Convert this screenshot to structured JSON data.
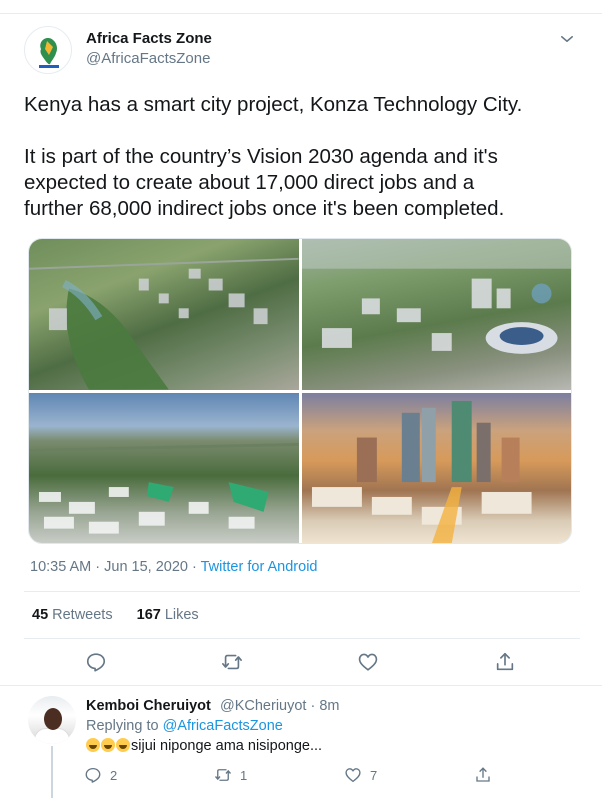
{
  "tweet": {
    "author_name": "Africa Facts Zone",
    "author_handle": "@AfricaFactsZone",
    "text_line1": "Kenya has a smart city project, Konza Technology City.",
    "text_line2": "It is part of the country’s Vision 2030 agenda and it's",
    "text_line3": "expected to create about 17,000 direct jobs and a",
    "text_line4": "further 68,000 indirect jobs once it's been completed.",
    "timestamp": "10:35 AM · Jun 15, 2020",
    "separator": " · ",
    "source": "Twitter for Android",
    "retweets_count": "45",
    "retweets_label": "Retweets",
    "likes_count": "167",
    "likes_label": "Likes",
    "media": [
      "city-render-1",
      "city-render-2",
      "city-render-3",
      "city-render-4"
    ]
  },
  "reply": {
    "author_name": "Kemboi Cheruiyot",
    "author_handle": "@KCheriuyot",
    "time": "· 8m",
    "replying_prefix": "Replying to",
    "replying_to": "@AfricaFactsZone",
    "text": "sijui niponge ama nisiponge...",
    "reply_count": "2",
    "retweet_count": "1",
    "like_count": "7"
  },
  "icons": {
    "more": "chevron-down-icon",
    "reply": "reply-icon",
    "retweet": "retweet-icon",
    "like": "heart-icon",
    "share": "share-icon"
  },
  "colors": {
    "link": "#1b95e0",
    "muted": "#657786",
    "text": "#14171a",
    "divider": "#e6ecf0"
  }
}
